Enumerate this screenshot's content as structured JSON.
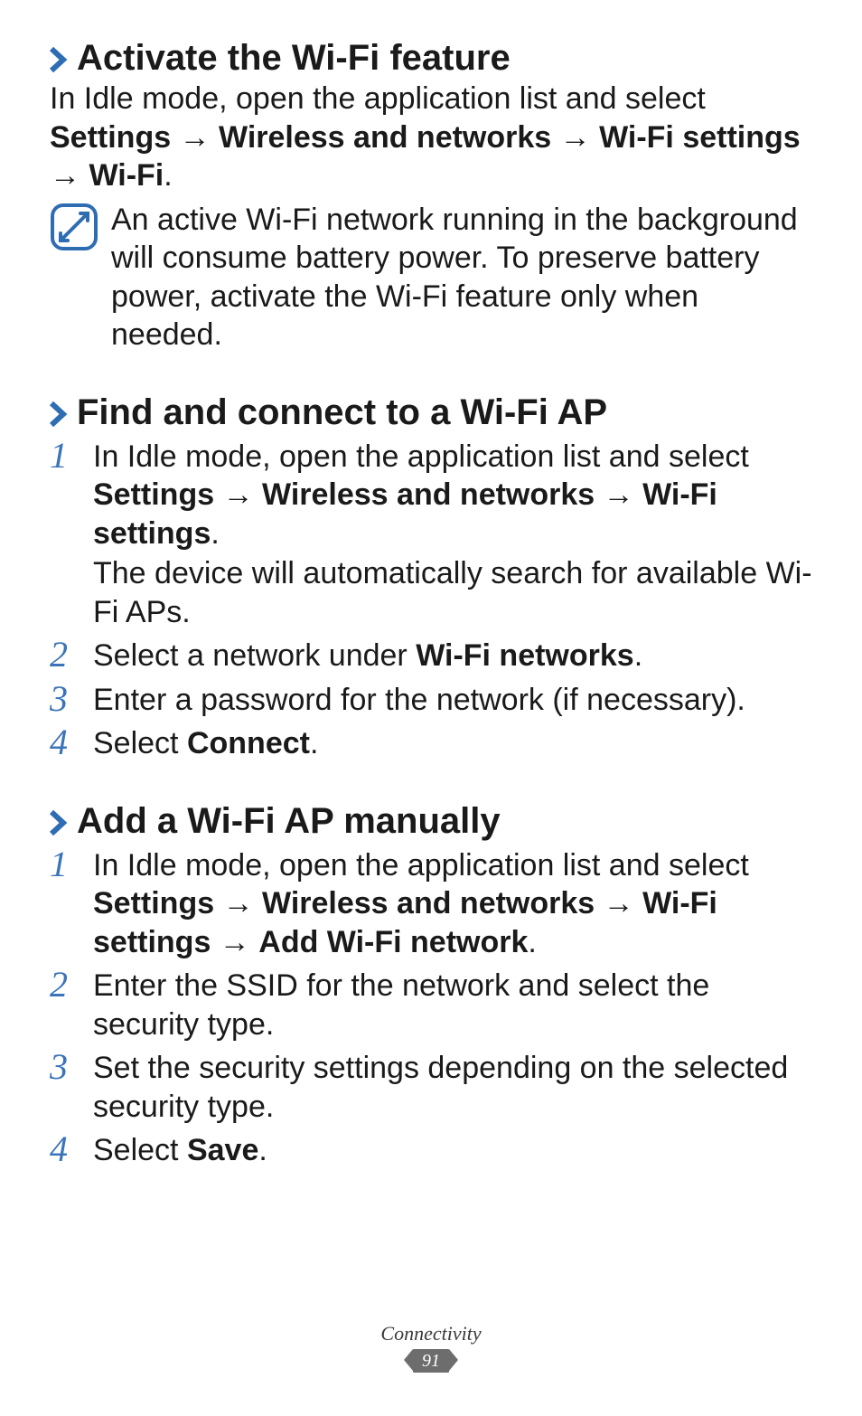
{
  "sections": {
    "s1": {
      "heading": "Activate the Wi-Fi feature",
      "intro_html": "In Idle mode, open the application list and select <span class='bold'>Settings</span> → <span class='bold'>Wireless and networks</span> → <span class='bold'>Wi-Fi settings</span> → <span class='bold'>Wi-Fi</span>.",
      "note": "An active Wi-Fi network running in the background will consume battery power. To preserve battery power, activate the Wi-Fi feature only when needed."
    },
    "s2": {
      "heading": "Find and connect to a Wi-Fi AP",
      "steps": [
        {
          "html": "In Idle mode, open the application list and select <span class='bold'>Settings</span> → <span class='bold'>Wireless and networks</span> → <span class='bold'>Wi-Fi settings</span>.",
          "sub": "The device will automatically search for available Wi-Fi APs."
        },
        {
          "html": "Select a network under <span class='bold'>Wi-Fi networks</span>."
        },
        {
          "html": "Enter a password for the network (if necessary)."
        },
        {
          "html": "Select <span class='bold'>Connect</span>."
        }
      ]
    },
    "s3": {
      "heading": "Add a Wi-Fi AP manually",
      "steps": [
        {
          "html": "In Idle mode, open the application list and select <span class='bold'>Settings</span> → <span class='bold'>Wireless and networks</span> → <span class='bold'>Wi-Fi settings</span> → <span class='bold'>Add Wi-Fi network</span>."
        },
        {
          "html": "Enter the SSID for the network and select the security type."
        },
        {
          "html": "Set the security settings depending on the selected security type."
        },
        {
          "html": "Select <span class='bold'>Save</span>."
        }
      ]
    }
  },
  "footer": {
    "section_label": "Connectivity",
    "page_number": "91"
  }
}
